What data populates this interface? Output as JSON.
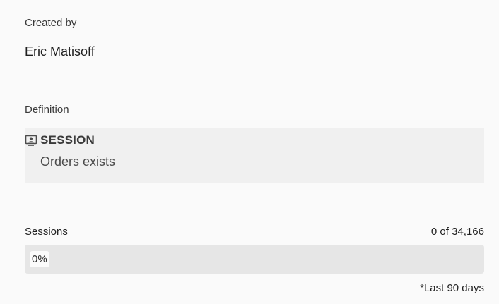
{
  "created_by": {
    "label": "Created by",
    "name": "Eric Matisoff"
  },
  "definition": {
    "label": "Definition",
    "container": {
      "icon": "session-container-icon",
      "label": "SESSION"
    },
    "rule": "Orders exists"
  },
  "sessions": {
    "label": "Sessions",
    "count_text": "0 of 34,166",
    "percent_text": "0%",
    "percent_value": 0
  },
  "footnote": "*Last 90 days",
  "colors": {
    "background": "#fafafa",
    "definition_box": "#f0f0f0",
    "progress_track": "#e6e6e6",
    "progress_fill": "#4b75d8"
  }
}
